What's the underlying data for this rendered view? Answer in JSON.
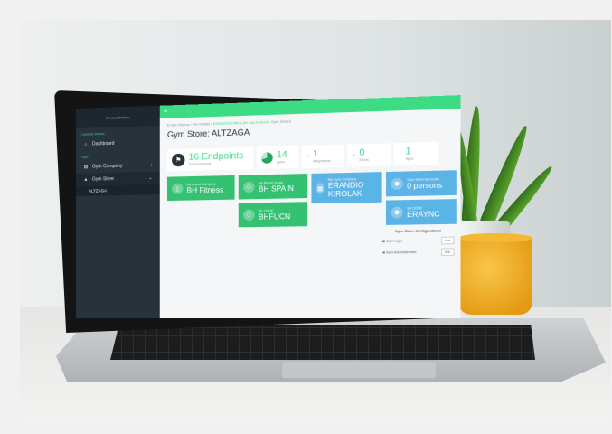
{
  "sidebar": {
    "logo": "Central Station",
    "section_main": "Central Stores",
    "dashboard": "Dashboard",
    "section_gym": "Gym",
    "gym_company": "Gym Company",
    "gym_store": "Gym Store",
    "gym_store_sub": "ALTZAGA"
  },
  "breadcrumb": {
    "prefix": "E78H Fitness / BH SPAIN / ",
    "active": "ERANDIO KIROLAK / ALTZAGA",
    "suffix": " / Gym Stores"
  },
  "page_title": "Gym Store: ALTZAGA",
  "stats": {
    "endpoints_value": "16 Endpoints",
    "endpoints_label": "Total Endpoints",
    "gyms_value": "14",
    "gyms_label": "gyms",
    "s3_value": "1",
    "s3_label": "Integrations",
    "s4_value": "0",
    "s4_label": "Errors",
    "s5_value": "1",
    "s5_label": "Apps"
  },
  "cards": {
    "company_label": "My Brand Company",
    "company_value": "BH Fitness",
    "group_label": "My Brand Group",
    "group_value": "BH SPAIN",
    "code_label": "BE CODE",
    "code_value": "BHFUCN",
    "gymco_label": "My Gym Company",
    "gymco_value": "ERANDIO KIROLAK",
    "accounts_label": "Gym Store Accounts",
    "accounts_value": "0 persons",
    "sync_label": "SII CODE",
    "sync_value": "ERAYNC"
  },
  "config": {
    "title": "Gym Store Configurations",
    "row1": "Gym Logo",
    "row2": "Gym Advertisement",
    "edit": "Edit"
  },
  "colors": {
    "accent": "#3ddc84",
    "sidebar": "#27323b",
    "card_green": "#34c172",
    "card_blue": "#5bb4e6"
  }
}
